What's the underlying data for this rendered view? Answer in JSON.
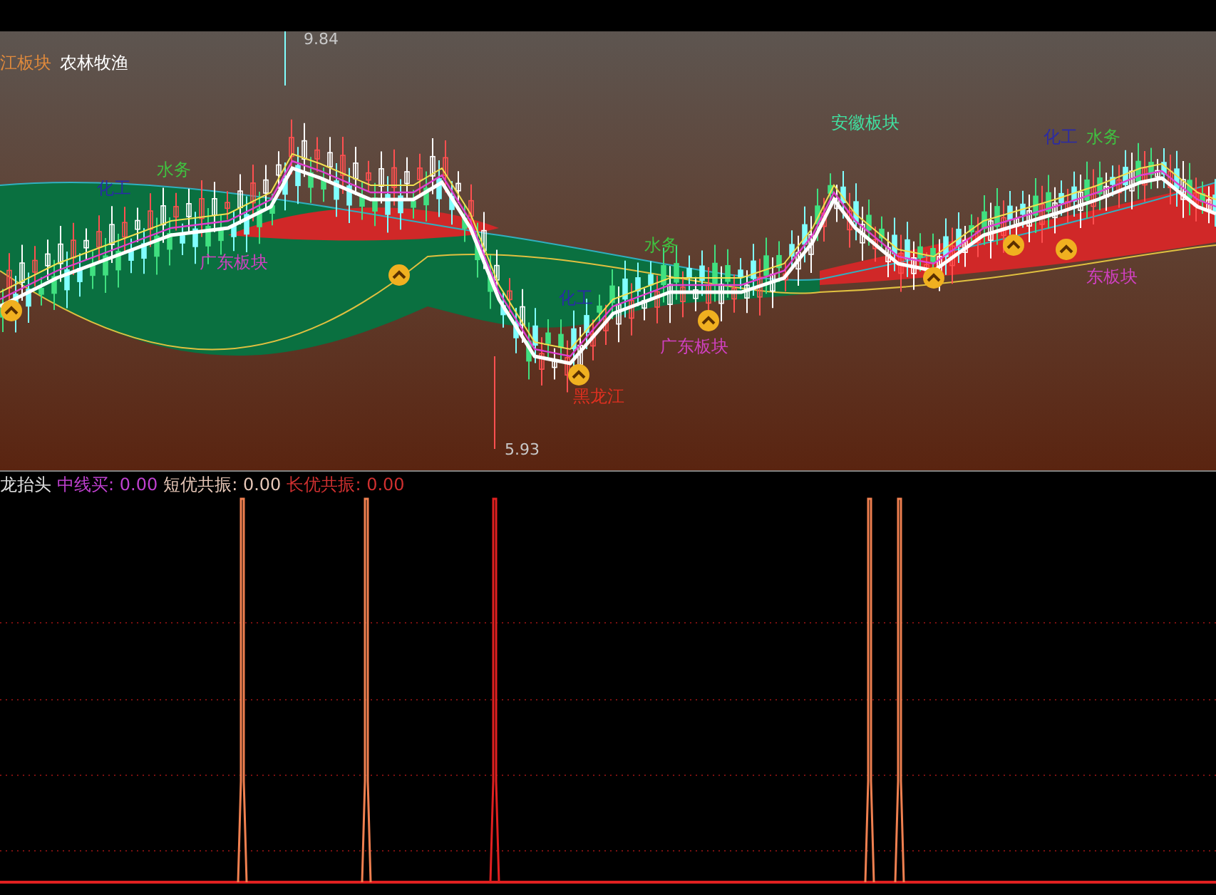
{
  "top_labels": [
    {
      "text": "江板块",
      "color": "#e08a3c"
    },
    {
      "text": "农林牧渔",
      "color": "#ffffff"
    }
  ],
  "chart_labels": [
    {
      "text": "化工",
      "color": "#2a2aa8"
    },
    {
      "text": "水务",
      "color": "#40c040"
    },
    {
      "text": "广东板块",
      "color": "#d040c0"
    },
    {
      "text": "水务",
      "color": "#40c040"
    },
    {
      "text": "化工",
      "color": "#2a2aa8"
    },
    {
      "text": "广东板块",
      "color": "#d040c0"
    },
    {
      "text": "黑龙江",
      "color": "#e03020"
    },
    {
      "text": "安徽板块",
      "color": "#40e0a0"
    },
    {
      "text": "化工",
      "color": "#2a2aa8"
    },
    {
      "text": "水务",
      "color": "#40c040"
    },
    {
      "text": "东板块",
      "color": "#d040c0"
    }
  ],
  "price_marks": {
    "high": "9.84",
    "low": "5.93"
  },
  "indicator": {
    "title": "龙抬头",
    "readings": [
      {
        "label": "中线买:",
        "value": "0.00",
        "color": "#c040d0"
      },
      {
        "label": "短优共振:",
        "value": "0.00",
        "color": "#e8c8b8"
      },
      {
        "label": "长优共振:",
        "value": "0.00",
        "color": "#d03030"
      }
    ]
  }
}
